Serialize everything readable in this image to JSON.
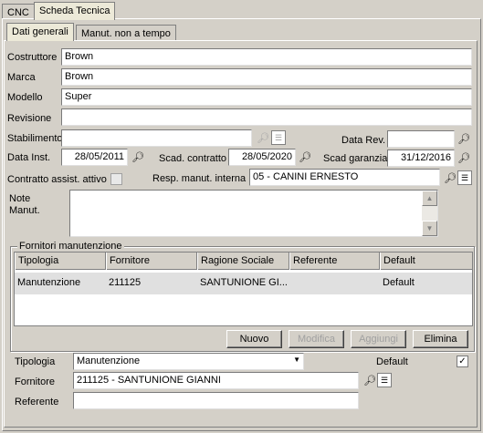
{
  "top_tabs": [
    "CNC",
    "Scheda Tecnica"
  ],
  "sub_tabs": [
    "Dati generali",
    "Manut. non a tempo"
  ],
  "fields": {
    "costruttore": {
      "label": "Costruttore",
      "value": "Brown"
    },
    "marca": {
      "label": "Marca",
      "value": "Brown"
    },
    "modello": {
      "label": "Modello",
      "value": "Super"
    },
    "revisione": {
      "label": "Revisione",
      "value": ""
    },
    "stabilimento": {
      "label": "Stabilimento",
      "value": ""
    },
    "data_rev": {
      "label": "Data Rev.",
      "value": ""
    },
    "data_inst": {
      "label": "Data Inst.",
      "value": "28/05/2011"
    },
    "scad_contratto": {
      "label": "Scad. contratto",
      "value": "28/05/2020"
    },
    "scad_garanzia": {
      "label": "Scad garanzia",
      "value": "31/12/2016"
    },
    "contratto": {
      "label": "Contratto assist. attivo"
    },
    "resp_manut": {
      "label": "Resp. manut. interna",
      "value": "05 - CANINI ERNESTO"
    },
    "note": {
      "label_1": "Note",
      "label_2": "Manut.",
      "value": ""
    }
  },
  "fornitori": {
    "title": "Fornitori manutenzione",
    "columns": [
      "Tipologia",
      "Fornitore",
      "Ragione Sociale",
      "Referente",
      "Default"
    ],
    "rows": [
      {
        "tipologia": "Manutenzione",
        "fornitore": "211125",
        "ragione_sociale": "SANTUNIONE GI...",
        "referente": "",
        "default": "Default"
      }
    ],
    "buttons": {
      "nuovo": "Nuovo",
      "modifica": "Modifica",
      "aggiungi": "Aggiungi",
      "elimina": "Elimina"
    }
  },
  "detail": {
    "tipologia_label": "Tipologia",
    "tipologia_value": "Manutenzione",
    "default_label": "Default",
    "default_checked": "✓",
    "fornitore_label": "Fornitore",
    "fornitore_value": "211125 - SANTUNIONE GIANNI",
    "referente_label": "Referente",
    "referente_value": ""
  },
  "icons": {
    "binoculars": "binoculars-icon",
    "document": "document-icon"
  }
}
